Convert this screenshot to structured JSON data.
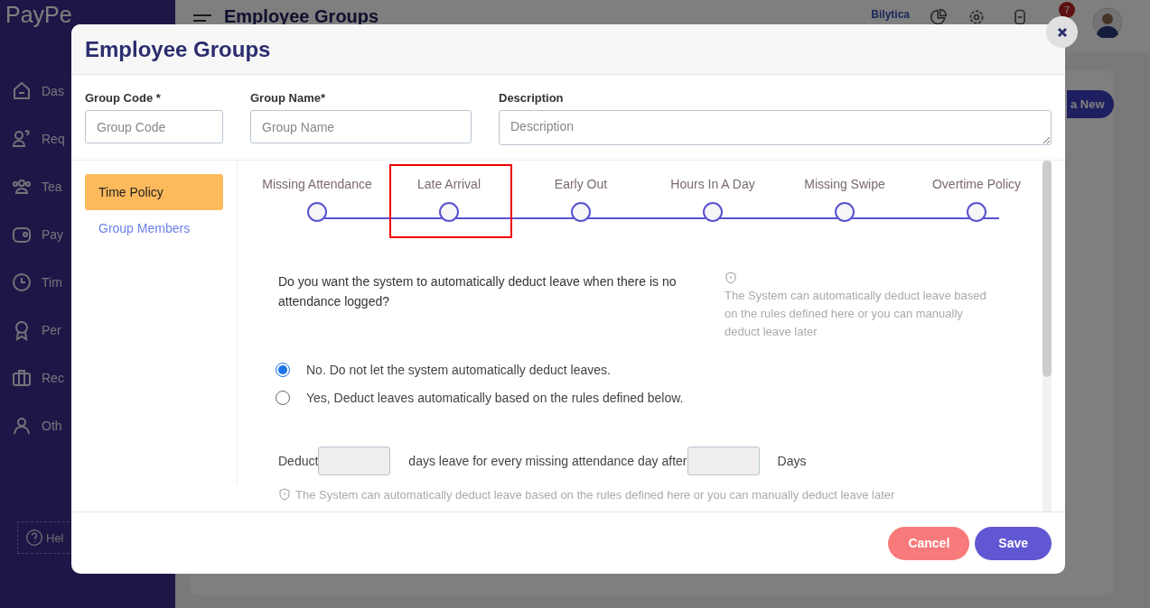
{
  "background": {
    "logo": "PayPe",
    "page_title": "Employee Groups",
    "company_link": "Bilytica",
    "notification_count": "7",
    "add_button": "a New",
    "sidebar": [
      {
        "label": "Das"
      },
      {
        "label": "Req"
      },
      {
        "label": "Tea"
      },
      {
        "label": "Pay"
      },
      {
        "label": "Tim"
      },
      {
        "label": "Per"
      },
      {
        "label": "Rec"
      },
      {
        "label": "Oth"
      }
    ],
    "help": "Hel"
  },
  "modal": {
    "title": "Employee Groups",
    "fields": [
      {
        "label": "Group Code *",
        "placeholder": "Group Code",
        "kind": "input"
      },
      {
        "label": "Group Name*",
        "placeholder": "Group Name",
        "kind": "input"
      },
      {
        "label": "Description",
        "placeholder": "Description",
        "kind": "textarea"
      }
    ],
    "nav": [
      {
        "label": "Time Policy",
        "selected": true
      },
      {
        "label": "Group Members",
        "selected": false
      }
    ],
    "steps": [
      {
        "label": "Missing Attendance",
        "highlighted": false
      },
      {
        "label": "Late Arrival",
        "highlighted": true
      },
      {
        "label": "Early Out",
        "highlighted": false
      },
      {
        "label": "Hours In A Day",
        "highlighted": false
      },
      {
        "label": "Missing Swipe",
        "highlighted": false
      },
      {
        "label": "Overtime Policy",
        "highlighted": false
      }
    ],
    "question": "Do you want the system to automatically deduct leave when there is no attendance logged?",
    "hint": "The System can automatically deduct leave based on the rules defined here or you can manually deduct leave later",
    "options": [
      {
        "label": "No. Do not let the system automatically deduct leaves.",
        "selected": true
      },
      {
        "label": "Yes, Deduct leaves automatically based on the rules defined below.",
        "selected": false
      }
    ],
    "deduct_row": {
      "before": "Deduct",
      "middle": "days leave for every missing attendance day after",
      "after": "Days"
    },
    "note": "The System can automatically deduct leave based on the rules defined here or you can manually deduct leave later",
    "buttons": [
      {
        "label": "Cancel",
        "kind": "cancel"
      },
      {
        "label": "Save",
        "kind": "primary"
      }
    ]
  }
}
